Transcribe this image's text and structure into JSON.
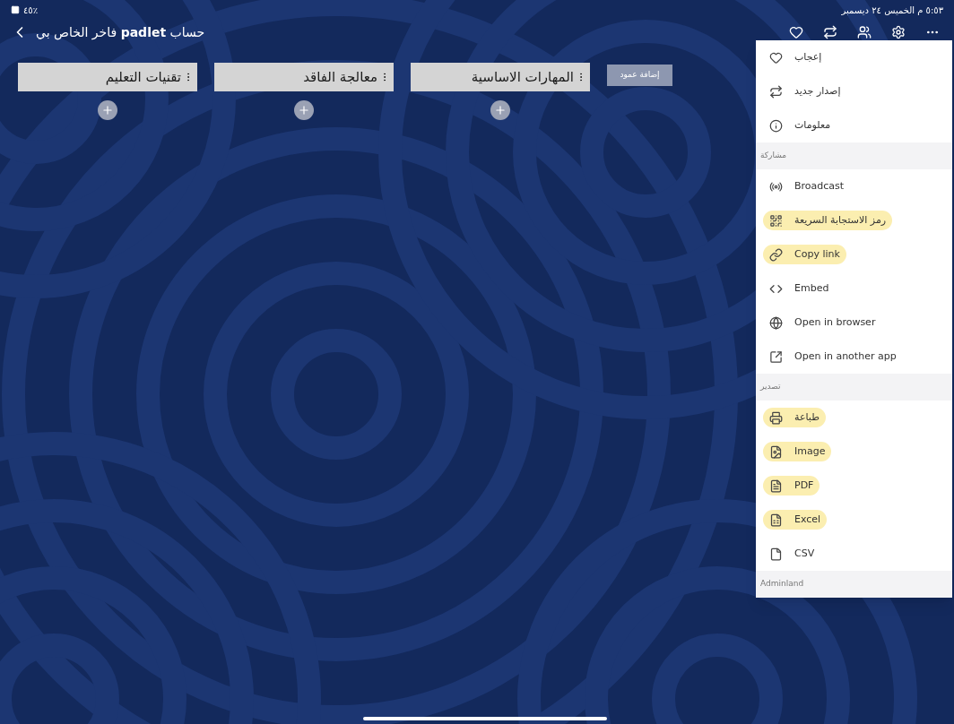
{
  "status_bar": {
    "battery": "٤٥٪",
    "clock": "٥:٥٣ م  الخميس ٢٤ ديسمبر"
  },
  "header": {
    "title": "حساب **padlet** فاخر الخاص بي"
  },
  "board": {
    "add_column": "إضافة عمود",
    "columns": [
      {
        "title": "المهارات الاساسية"
      },
      {
        "title": "معالجة الفاقد"
      },
      {
        "title": "تقنيات التعليم"
      }
    ]
  },
  "menu": {
    "sections": [
      {
        "items": [
          {
            "label": "إعجاب",
            "highlighted": false
          },
          {
            "label": "إصدار جديد",
            "highlighted": false
          },
          {
            "label": "معلومات",
            "highlighted": false
          }
        ]
      },
      {
        "title": "مشاركة",
        "items": [
          {
            "label": "Broadcast",
            "highlighted": false
          },
          {
            "label": "رمز الاستجابة السريعة",
            "highlighted": true
          },
          {
            "label": "Copy link",
            "highlighted": true
          },
          {
            "label": "Embed",
            "highlighted": false
          },
          {
            "label": "Open in browser",
            "highlighted": false
          },
          {
            "label": "Open in another app",
            "highlighted": false
          }
        ]
      },
      {
        "title": "تصدير",
        "items": [
          {
            "label": "طباعة",
            "highlighted": true
          },
          {
            "label": "Image",
            "highlighted": true
          },
          {
            "label": "PDF",
            "highlighted": true
          },
          {
            "label": "Excel",
            "highlighted": true
          },
          {
            "label": "CSV",
            "highlighted": false
          }
        ]
      },
      {
        "title": "Adminland"
      }
    ]
  }
}
